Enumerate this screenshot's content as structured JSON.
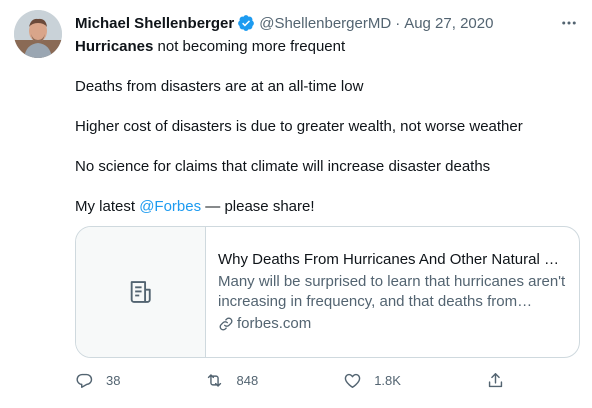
{
  "author": {
    "name": "Michael Shellenberger",
    "handle": "@ShellenbergerMD",
    "separator": "·",
    "date": "Aug 27, 2020",
    "verified": true
  },
  "tweet": {
    "line1_bold": "Hurricanes",
    "line1_rest": " not becoming more frequent",
    "line2": "Deaths from disasters are at an all-time low",
    "line3": "Higher cost of disasters is due to greater wealth, not worse weather",
    "line4": "No science for claims that climate will increase disaster deaths",
    "line5_pre": "My latest ",
    "line5_mention": "@Forbes",
    "line5_post": " — please share!"
  },
  "card": {
    "title": "Why Deaths From Hurricanes And Other Natural Disasters Are At An All-Time Low",
    "description": "Many will be surprised to learn that hurricanes aren't increasing in frequency, and that deaths from natural disasters are at an all-time low.",
    "domain": "forbes.com",
    "thumb_icon": "article-icon"
  },
  "actions": {
    "replies": "38",
    "retweets": "848",
    "likes": "1.8K",
    "share_icon": "share-icon"
  },
  "colors": {
    "text": "#0f1419",
    "secondary": "#536471",
    "accent": "#1d9bf0",
    "border": "#cfd9de"
  }
}
